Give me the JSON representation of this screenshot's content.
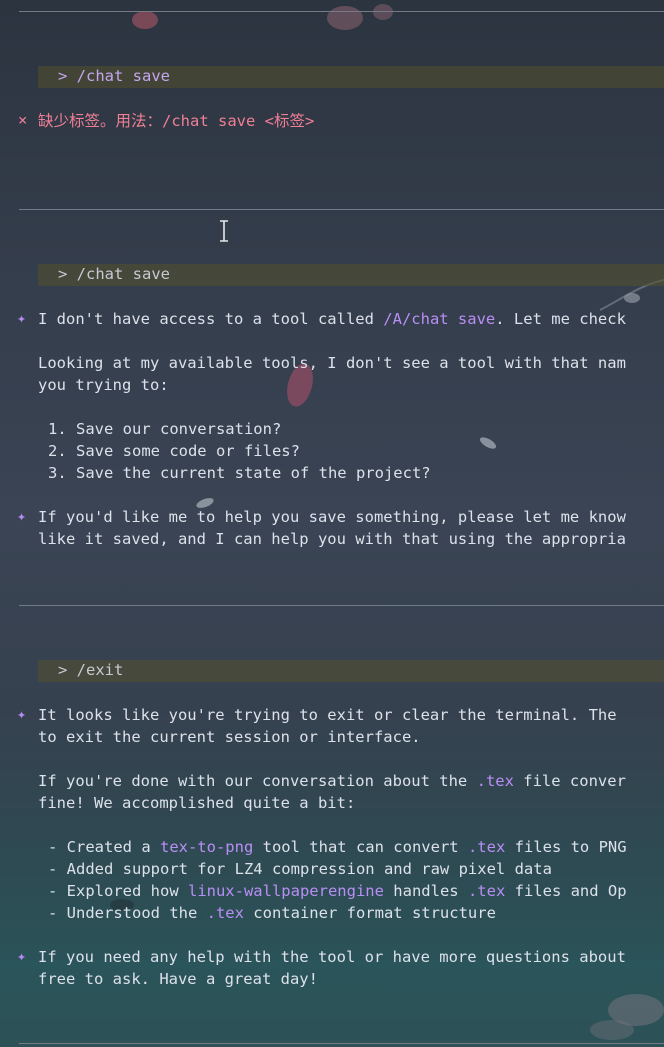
{
  "blocks": [
    {
      "prompt": "> /chat save",
      "error_mark": "×",
      "error_text": "缺少标签。用法：/chat save <标签>"
    },
    {
      "prompt": "> /chat save",
      "response1": {
        "mark": "✦",
        "pre": "I don't have access to a tool called ",
        "hl": "/A/chat save",
        "post": ". Let me check"
      },
      "para": [
        "Looking at my available tools, I don't see a tool with that nam",
        "you trying to:"
      ],
      "list": [
        "1. Save our conversation?",
        "2. Save some code or files?",
        "3. Save the current state of the project?"
      ],
      "response2": {
        "mark": "✦",
        "lines": [
          "If you'd like me to help you save something, please let me know",
          "like it saved, and I can help you with that using the appropria"
        ]
      }
    },
    {
      "prompt": "> /exit",
      "response1": {
        "mark": "✦",
        "lines": [
          "It looks like you're trying to exit or clear the terminal. The",
          "to exit the current session or interface."
        ]
      },
      "para_a": {
        "pre": "If you're done with our conversation about the ",
        "hl": ".tex",
        "post": " file conver"
      },
      "para_b": "fine! We accomplished quite a bit:",
      "bullets": [
        {
          "p1": "- Created a ",
          "h1": "tex-to-png",
          "p2": " tool that can convert ",
          "h2": ".tex",
          "p3": " files to PNG"
        },
        {
          "p1": "- Added support for LZ4 compression and raw pixel data",
          "h1": "",
          "p2": "",
          "h2": "",
          "p3": ""
        },
        {
          "p1": "- Explored how ",
          "h1": "linux-wallpaperengine",
          "p2": " handles ",
          "h2": ".tex",
          "p3": " files and Op"
        },
        {
          "p1": "- Understood the ",
          "h1": ".tex",
          "p2": " container format structure",
          "h2": "",
          "p3": ""
        }
      ],
      "response2": {
        "mark": "✦",
        "lines": [
          "If you need any help with the tool or have more questions about",
          "free to ask. Have a great day!"
        ]
      }
    }
  ],
  "colors": {
    "accent": "#b98ef5",
    "error": "#ef7f95",
    "text": "#dce1ea",
    "prompt_bg": "#54502c"
  }
}
